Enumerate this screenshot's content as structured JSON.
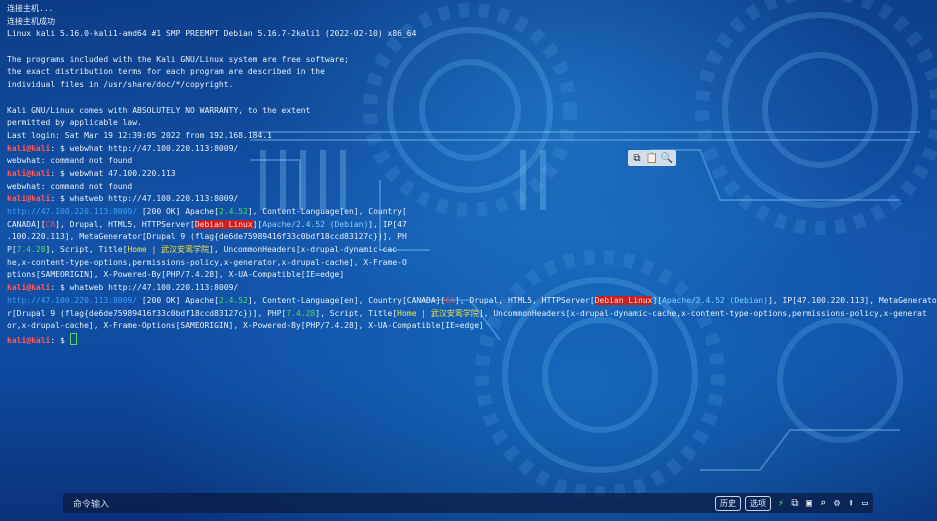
{
  "terminal": {
    "lines": [
      [
        {
          "t": "连接主机..."
        }
      ],
      [
        {
          "t": "连接主机成功"
        }
      ],
      [
        {
          "t": "Linux kali 5.16.0-kali1-amd64 #1 SMP PREEMPT Debian 5.16.7-2kali1 (2022-02-10) x86_64"
        }
      ],
      [
        {
          "t": ""
        }
      ],
      [
        {
          "t": "The programs included with the Kali GNU/Linux system are free software;"
        }
      ],
      [
        {
          "t": "the exact distribution terms for each program are described in the"
        }
      ],
      [
        {
          "t": "individual files in /usr/share/doc/*/copyright."
        }
      ],
      [
        {
          "t": ""
        }
      ],
      [
        {
          "t": "Kali GNU/Linux comes with ABSOLUTELY NO WARRANTY, to the extent"
        }
      ],
      [
        {
          "t": "permitted by applicable law."
        }
      ],
      [
        {
          "t": "Last login: Sat Mar 19 12:39:05 2022 from 192.168.184.1"
        }
      ],
      [
        {
          "t": "kali@kali",
          "c": "prompt-user"
        },
        {
          "t": ": $ webwhat http://47.100.220.113:8009/"
        }
      ],
      [
        {
          "t": "webwhat: command not found"
        }
      ],
      [
        {
          "t": "kali@kali",
          "c": "prompt-user"
        },
        {
          "t": ": $ webwhat 47.100.220.113"
        }
      ],
      [
        {
          "t": "webwhat: command not found"
        }
      ],
      [
        {
          "t": "kali@kali",
          "c": "prompt-user"
        },
        {
          "t": ": $ whatweb http://47.100.220.113:8009/"
        }
      ],
      [
        {
          "t": "http://47.100.220.113:8009/",
          "c": "url"
        },
        {
          "t": " [200 OK] Apache["
        },
        {
          "t": "2.4.52",
          "c": "green"
        },
        {
          "t": "], Content-Language[en], Country["
        }
      ],
      [
        {
          "t": "CANADA]["
        },
        {
          "t": "CA",
          "c": "red"
        },
        {
          "t": "], Drupal, HTML5, HTTPServer["
        },
        {
          "t": "Debian Linux",
          "c": "redbg"
        },
        {
          "t": "]["
        },
        {
          "t": "Apache/2.4.52 (Debian)",
          "c": "cyan"
        },
        {
          "t": "], IP[47"
        }
      ],
      [
        {
          "t": ".100.220.113], MetaGenerator[Drupal 9 (flag{de6de75989416f33c0bdf18ccd83127c})], PH"
        }
      ],
      [
        {
          "t": "P["
        },
        {
          "t": "7.4.28",
          "c": "green"
        },
        {
          "t": "], Script, Title["
        },
        {
          "t": "Home | 武汉安鸾学院",
          "c": "yellow"
        },
        {
          "t": "], UncommonHeaders[x-drupal-dynamic-cac"
        }
      ],
      [
        {
          "t": "he,x-content-type-options,permissions-policy,x-generator,x-drupal-cache], X-Frame-O"
        }
      ],
      [
        {
          "t": "ptions[SAMEORIGIN], X-Powered-By[PHP/7.4.28], X-UA-Compatible[IE=edge]"
        }
      ],
      [
        {
          "t": "kali@kali",
          "c": "prompt-user"
        },
        {
          "t": ": $ whatweb http://47.100.220.113:8009/"
        }
      ],
      [
        {
          "t": "http://47.100.220.113:8009/",
          "c": "url"
        },
        {
          "t": " [200 OK] Apache["
        },
        {
          "t": "2.4.52",
          "c": "green"
        },
        {
          "t": "], Content-Language[en], Country[CANADA]["
        },
        {
          "t": "CA",
          "c": "red"
        },
        {
          "t": "], Drupal, HTML5, HTTPServer["
        },
        {
          "t": "Debian Linux",
          "c": "redbg"
        },
        {
          "t": "]["
        },
        {
          "t": "Apache/2.4.52 (Debian)",
          "c": "cyan"
        },
        {
          "t": "], IP[47.100.220.113], MetaGenerato"
        }
      ],
      [
        {
          "t": "r[Drupal 9 (flag{de6de75989416f33c0bdf18ccd83127c})], PHP["
        },
        {
          "t": "7.4.28",
          "c": "green"
        },
        {
          "t": "], Script, Title["
        },
        {
          "t": "Home | 武汉安鸾学院",
          "c": "yellow"
        },
        {
          "t": "], UncommonHeaders[x-drupal-dynamic-cache,x-content-type-options,permissions-policy,x-generat"
        }
      ],
      [
        {
          "t": "or,x-drupal-cache], X-Frame-Options[SAMEORIGIN], X-Powered-By[PHP/7.4.28], X-UA-Compatible[IE=edge]"
        }
      ],
      [
        {
          "t": "kali@kali",
          "c": "prompt-user"
        },
        {
          "t": ": $ "
        }
      ]
    ]
  },
  "floating_toolbar": {
    "icons": [
      "copy-icon",
      "paste-icon",
      "search-icon"
    ]
  },
  "input_bar": {
    "placeholder_label": "命令输入",
    "history_label": "历史",
    "options_label": "选项",
    "icons": [
      "lightning-icon",
      "copy-icon",
      "paste-icon",
      "search-icon",
      "gear-icon",
      "arrow-up-icon",
      "window-icon"
    ]
  }
}
